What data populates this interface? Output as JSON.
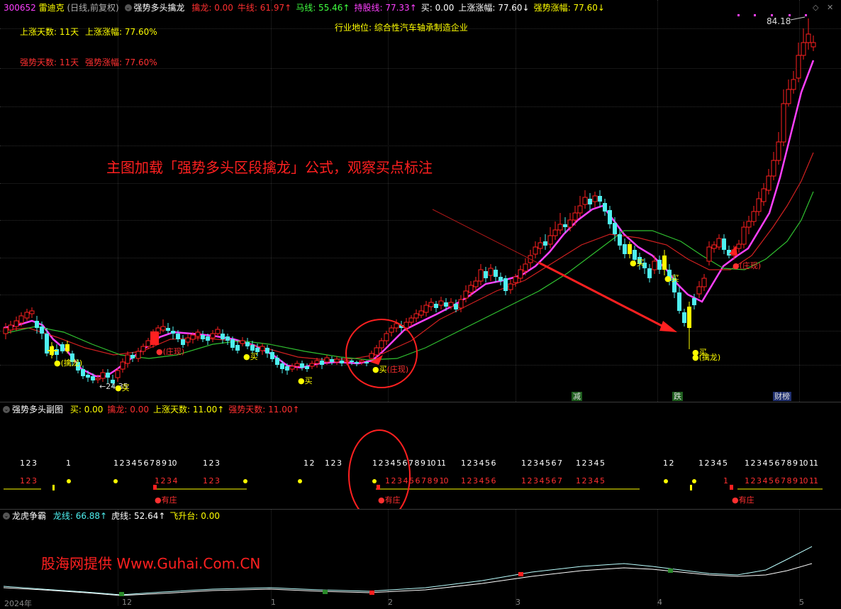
{
  "main_header": {
    "code": "300652",
    "name": "雷迪克",
    "period": "(日线,前复权)",
    "formula": "强势多头擒龙",
    "items": [
      {
        "label": "擒龙:",
        "value": "0.00",
        "color": "#ff3030"
      },
      {
        "label": "牛线:",
        "value": "61.97",
        "color": "#ff3030",
        "arrow": "↑"
      },
      {
        "label": "马线:",
        "value": "55.46",
        "color": "#40ff40",
        "arrow": "↑"
      },
      {
        "label": "持股线:",
        "value": "77.33",
        "color": "#ff40ff",
        "arrow": "↑"
      },
      {
        "label": "买:",
        "value": "0.00",
        "color": "#ffffff"
      },
      {
        "label": "上涨涨幅:",
        "value": "77.60",
        "color": "#ffffff",
        "arrow": "↓"
      },
      {
        "label": "强势涨幅:",
        "value": "77.60",
        "color": "#ffff00",
        "arrow": "↓"
      }
    ]
  },
  "info_lines": {
    "up_days": "上涨天数: 11天",
    "up_gain": "上涨涨幅: 77.60%",
    "strong_days": "强势天数: 11天",
    "strong_gain": "强势涨幅: 77.60%",
    "industry": "行业地位: 综合性汽车轴承制造企业"
  },
  "annotation_text": "主图加载「强势多头区段擒龙」公式，观察买点标注",
  "price_marks": {
    "high": "84.18",
    "low": "24.35"
  },
  "chart_labels": {
    "buy": "买",
    "zhuang": "(庄现)",
    "qinlong": "(擒龙)",
    "youzhuang": "有庄",
    "zhuang_hidden": "(庄现)"
  },
  "events": [
    "减",
    "跌",
    "财榜"
  ],
  "sub1_header": {
    "formula": "强势多头副图",
    "items": [
      {
        "label": "买:",
        "value": "0.00",
        "color": "#ffff00"
      },
      {
        "label": "擒龙:",
        "value": "0.00",
        "color": "#ff3030"
      },
      {
        "label": "上涨天数:",
        "value": "11.00",
        "color": "#ffff00",
        "arrow": "↑"
      },
      {
        "label": "强势天数:",
        "value": "11.00",
        "color": "#ff3030",
        "arrow": "↑"
      }
    ]
  },
  "sub1_counts_white": [
    "1 2 3",
    "1",
    "1 2 3 4 5 6 7 8 9 10",
    "1 2 3",
    "1 2",
    "1 2 3",
    "1 2 3 4 5 6 7 8 9 10 11",
    "1 2 3 4 5 6",
    "1 2 3 4 5 6 7",
    "1 2 3 4 5",
    "1 2",
    "1 2 3 4 5",
    "1 2 3 4 5 6 7 8 9 10 11"
  ],
  "sub1_counts_red": [
    "1 2 3",
    "1 2 3 4",
    "1 2 3",
    "1 2 3 4 5 6 7 8 9 10",
    "1 2 3 4 5 6",
    "1 2 3 4 5 6 7",
    "1 2 3 4 5",
    "1",
    "1 2 3 4 5 6 7 8 9 10 11"
  ],
  "sub2_header": {
    "formula": "龙虎争霸",
    "items": [
      {
        "label": "龙线:",
        "value": "66.88",
        "color": "#4ef0f0",
        "arrow": "↑"
      },
      {
        "label": "虎线:",
        "value": "52.64",
        "color": "#ffffff",
        "arrow": "↑"
      },
      {
        "label": "飞升台:",
        "value": "0.00",
        "color": "#ffff00"
      }
    ]
  },
  "source_text": "股海网提供 Www.Guhai.Com.CN",
  "time_axis": [
    "2024年",
    "12",
    "1",
    "2",
    "3",
    "4",
    "5"
  ],
  "colors": {
    "up": "#ff2020",
    "down": "#4ef0f0",
    "ma_bull": "#ff2020",
    "ma_horse": "#20ff20",
    "hold": "#ff40ff"
  }
}
